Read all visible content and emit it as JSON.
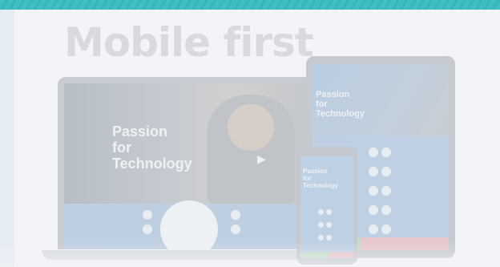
{
  "headline": "Mobile first",
  "laptop": {
    "tagline_lines": [
      "Passion",
      "for",
      "Technology"
    ]
  },
  "tablet": {
    "tagline_lines": [
      "Passion",
      "for",
      "Technology"
    ]
  },
  "phone": {
    "tagline_lines": [
      "Passion",
      "for",
      "Technology"
    ]
  },
  "icons": [
    "play-icon"
  ],
  "colors": {
    "accent_bar": "#3fbfc4",
    "headline": "#d8dade",
    "device_frame": "#c8ccd2",
    "screen_blue": "#bfd0e4"
  }
}
